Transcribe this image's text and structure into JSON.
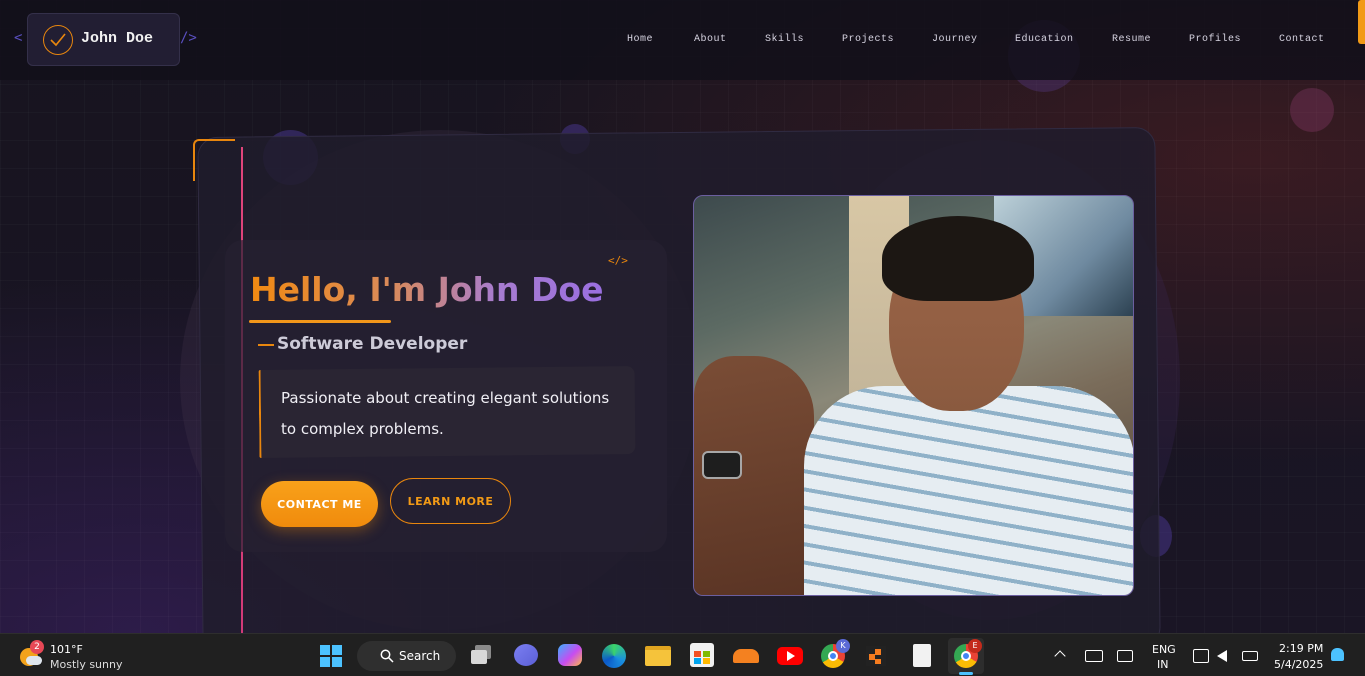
{
  "logo": {
    "name": "John Doe",
    "bracket_left": "<",
    "bracket_right": "/>"
  },
  "nav": {
    "items": [
      "Home",
      "About",
      "Skills",
      "Projects",
      "Journey",
      "Education",
      "Resume",
      "Profiles",
      "Contact"
    ]
  },
  "hero": {
    "code_tag": "</>",
    "greeting": "Hello, I'm John Doe",
    "role": "Software Developer",
    "description": "Passionate about creating elegant solutions to complex problems.",
    "contact_label": "CONTACT ME",
    "learn_label": "LEARN MORE"
  },
  "taskbar": {
    "weather_temp": "101°F",
    "weather_desc": "Mostly sunny",
    "weather_badge": "2",
    "search_label": "Search",
    "lang_line1": "ENG",
    "lang_line2": "IN",
    "time": "2:19 PM",
    "date": "5/4/2025",
    "chrome_badge_k": "K",
    "chrome_badge_e": "E"
  },
  "colors": {
    "accent": "#f29a16",
    "purple": "#9a6fe0",
    "pink": "#e0457b",
    "taskbar": "#202020"
  }
}
